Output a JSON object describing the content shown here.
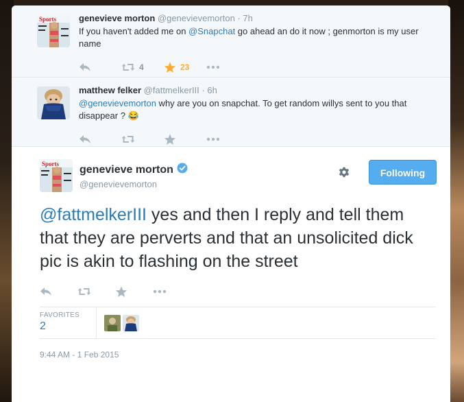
{
  "tweets_above": [
    {
      "fullname": "genevieve morton",
      "screenname": "@genevievemorton",
      "separator": "·",
      "time": "7h",
      "text_before": "If you haven't added me on ",
      "text_link": "@Snapchat",
      "text_after": " go ahead an do it now ; genmorton is my user name",
      "retweets": "4",
      "favorites": "23"
    },
    {
      "fullname": "matthew felker",
      "screenname": "@fattmelkerIII",
      "separator": "·",
      "time": "6h",
      "text_link": "@genevievemorton",
      "text_after": " why are you on snapchat.  To get random willys sent to you that disappear ? 😂"
    }
  ],
  "main_tweet": {
    "fullname": "genevieve morton",
    "screenname": "@genevievemorton",
    "follow_label": "Following",
    "text_link": "@fattmelkerIII",
    "text_after": " yes and then I reply and tell them that they are perverts and that an unsolicited dick pic is akin to flashing on the street",
    "favorites_label": "FAVORITES",
    "favorites_count": "2",
    "timestamp": "9:44 AM - 1 Feb 2015"
  },
  "icons": [
    "reply-icon",
    "retweet-icon",
    "favorite-icon",
    "more-icon",
    "gear-icon",
    "verified-icon"
  ],
  "colors": {
    "link": "#2b7bb9",
    "follow_button": "#55acee",
    "favorite_active": "#ffac33",
    "icon_gray": "#aab8c2"
  }
}
